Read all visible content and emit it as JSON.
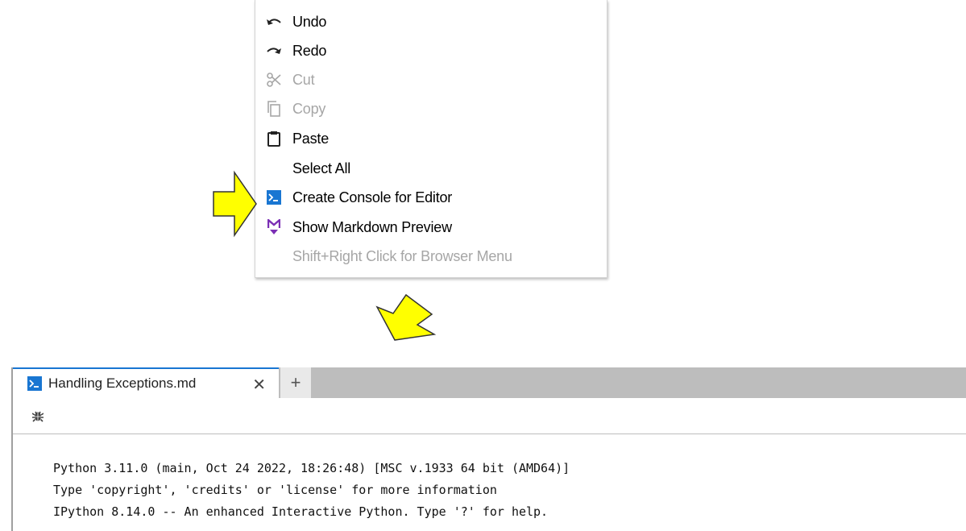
{
  "context_menu": {
    "items": [
      {
        "label": "Undo",
        "icon": "undo-icon",
        "enabled": true
      },
      {
        "label": "Redo",
        "icon": "redo-icon",
        "enabled": true
      },
      {
        "label": "Cut",
        "icon": "scissors-icon",
        "enabled": false
      },
      {
        "label": "Copy",
        "icon": "copy-icon",
        "enabled": false
      },
      {
        "label": "Paste",
        "icon": "clipboard-icon",
        "enabled": true
      },
      {
        "label": "Select All",
        "icon": "",
        "enabled": true
      },
      {
        "label": "Create Console for Editor",
        "icon": "console-icon",
        "enabled": true
      },
      {
        "label": "Show Markdown Preview",
        "icon": "markdown-icon",
        "enabled": true
      },
      {
        "label": "Shift+Right Click for Browser Menu",
        "icon": "",
        "enabled": false
      }
    ]
  },
  "console_panel": {
    "tab_title": "Handling Exceptions.md",
    "tab_close": "✕",
    "add_tab": "+",
    "output_lines": [
      "Python 3.11.0 (main, Oct 24 2022, 18:26:48) [MSC v.1933 64 bit (AMD64)]",
      "Type 'copyright', 'credits' or 'license' for more information",
      "IPython 8.14.0 -- An enhanced Interactive Python. Type '?' for help."
    ]
  },
  "colors": {
    "arrow_fill": "#ffff00",
    "console_icon": "#1976d2",
    "markdown_icon": "#7b2fb5",
    "disabled_text": "#a6a6a6"
  }
}
